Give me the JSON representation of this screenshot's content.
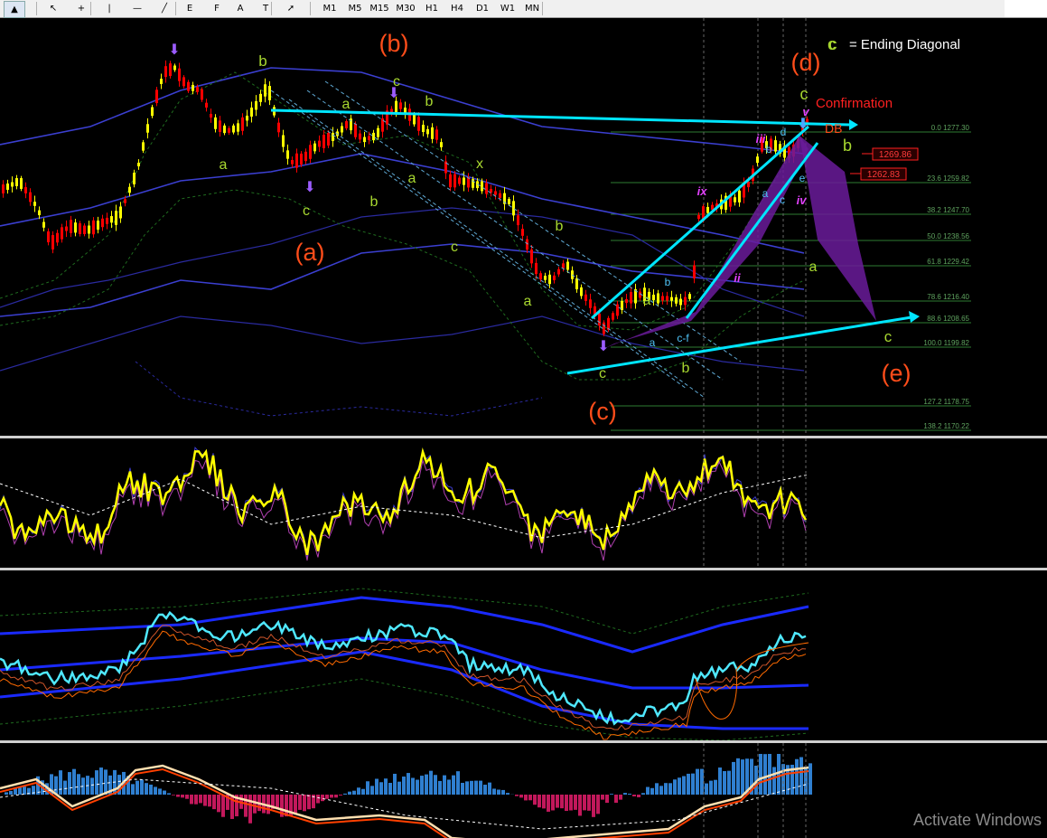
{
  "toolbar": {
    "timeframes": [
      "M1",
      "M5",
      "M15",
      "M30",
      "H1",
      "H4",
      "D1",
      "W1",
      "MN"
    ],
    "tools": [
      "chart-type-icon",
      "cursor-icon",
      "crosshair-icon",
      "vertical-line-icon",
      "horizontal-line-icon",
      "trendline-icon",
      "fibonacci-fan-icon",
      "fibonacci-retracement-icon",
      "text-icon",
      "text-label-icon",
      "arrow-shapes-icon"
    ],
    "tool_glyphs": [
      "▲",
      "↖",
      "+",
      "|",
      "—",
      "╱",
      "E",
      "F",
      "A",
      "T",
      "➚"
    ]
  },
  "main_chart": {
    "legend_c": "c",
    "legend_text": "= Ending Diagonal",
    "confirmation": "Confirmation",
    "db_label": "DB",
    "price_tags": [
      "1269.86",
      "1262.83"
    ],
    "fib_levels": [
      {
        "label": "0.0 1277.30"
      },
      {
        "label": "23.6 1259.82"
      },
      {
        "label": "38.2 1247.70"
      },
      {
        "label": "50.0 1238.56"
      },
      {
        "label": "61.8 1229.42"
      },
      {
        "label": "78.6 1216.40"
      },
      {
        "label": "88.6 1208.65"
      },
      {
        "label": "100.0 1199.82"
      },
      {
        "label": "127.2 1178.75"
      },
      {
        "label": "138.2 1170.22"
      }
    ],
    "wave_major": [
      "(a)",
      "(b)",
      "(c)",
      "(d)",
      "(e)"
    ],
    "colors": {
      "background": "#000000",
      "bull_candle": "#ffff00",
      "bear_candle": "#ff0000",
      "channel": "#00e5ff",
      "wave_green": "#a8d830",
      "wave_major": "#ff4d1a",
      "pattern": "#6a1b9a",
      "fib": "#2e7d32"
    }
  },
  "watermark": "Activate Windows"
}
